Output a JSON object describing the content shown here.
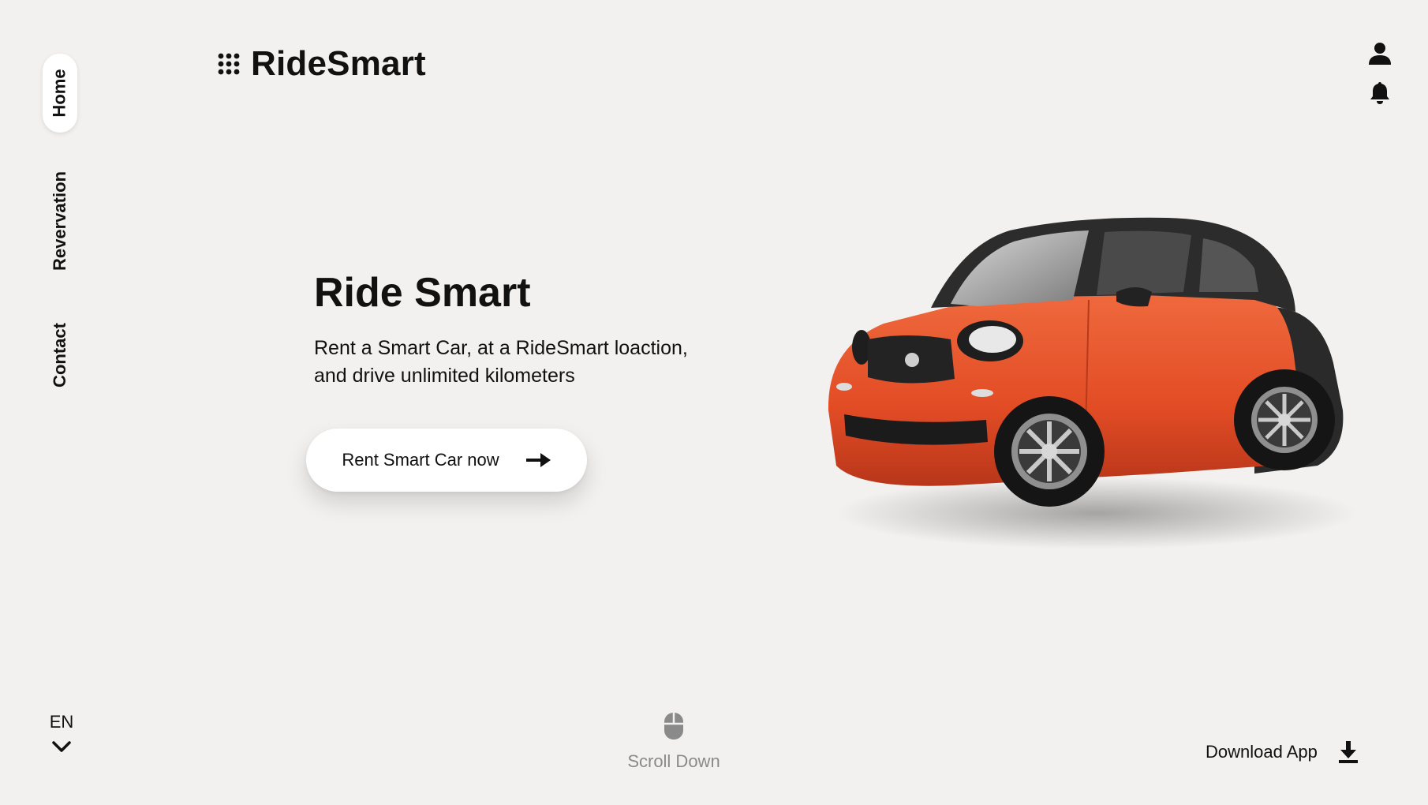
{
  "brand": {
    "name": "RideSmart",
    "menu_icon": "grid-dots-icon"
  },
  "nav": {
    "items": [
      {
        "label": "Home",
        "active": true
      },
      {
        "label": "Revervation",
        "active": false
      },
      {
        "label": "Contact",
        "active": false
      }
    ]
  },
  "header": {
    "icons": [
      "user-icon",
      "bell-icon"
    ]
  },
  "hero": {
    "title": "Ride Smart",
    "subtitle": "Rent a Smart Car, at a RideSmart loaction, and drive unlimited kilometers",
    "cta_label": "Rent Smart Car now",
    "cta_icon": "arrow-right-icon"
  },
  "language": {
    "code": "EN",
    "icon": "chevron-down-icon"
  },
  "scroll": {
    "label": "Scroll Down",
    "icon": "mouse-icon"
  },
  "download": {
    "label": "Download App",
    "icon": "download-icon"
  },
  "colors": {
    "background": "#f3f1ef",
    "car_body": "#e8512a",
    "car_roof": "#2b2b2b",
    "text": "#111111",
    "muted": "#8a8a8a"
  }
}
